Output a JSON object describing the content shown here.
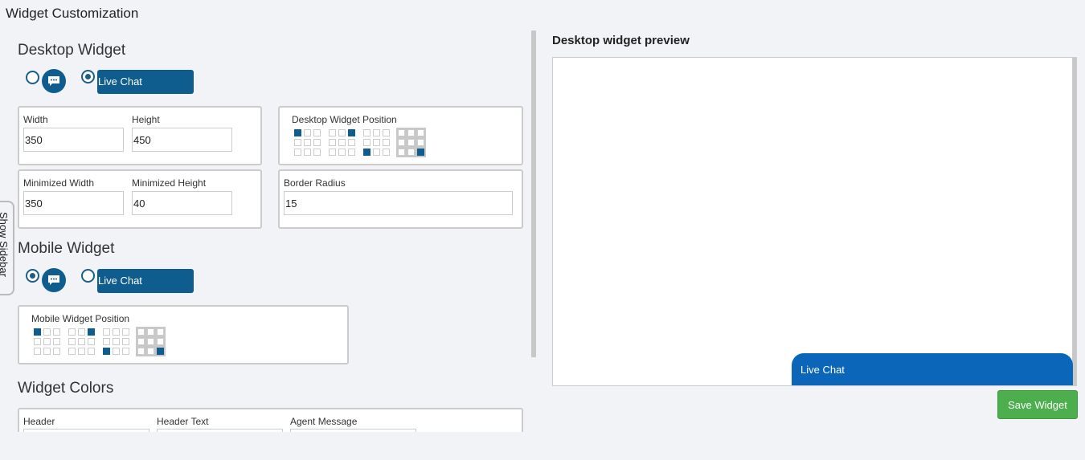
{
  "page": {
    "title": "Widget Customization"
  },
  "sidebar_toggle": {
    "label": "Show Sidebar"
  },
  "desktop": {
    "section_title": "Desktop Widget",
    "style_options": {
      "bubble_selected": false,
      "tab_selected": true,
      "tab_label": "Live Chat"
    },
    "width_label": "Width",
    "width_value": "350",
    "height_label": "Height",
    "height_value": "450",
    "min_width_label": "Minimized Width",
    "min_width_value": "350",
    "min_height_label": "Minimized Height",
    "min_height_value": "40",
    "position_label": "Desktop Widget Position",
    "border_radius_label": "Border Radius",
    "border_radius_value": "15",
    "selected_position": "bottom-right"
  },
  "mobile": {
    "section_title": "Mobile Widget",
    "style_options": {
      "bubble_selected": true,
      "tab_selected": false,
      "tab_label": "Live Chat"
    },
    "position_label": "Mobile Widget Position",
    "selected_position": "bottom-right"
  },
  "colors": {
    "section_title": "Widget Colors",
    "header_label": "Header",
    "header_text_label": "Header Text",
    "agent_message_label": "Agent Message"
  },
  "preview": {
    "title": "Desktop widget preview",
    "chat_label": "Live Chat"
  },
  "actions": {
    "save_label": "Save Widget"
  },
  "theme": {
    "primary": "#0f5d8e",
    "preview_blue": "#0b65b8",
    "save_green": "#4cae4c"
  },
  "icons": {
    "bubble": "chat-bubble-icon"
  }
}
